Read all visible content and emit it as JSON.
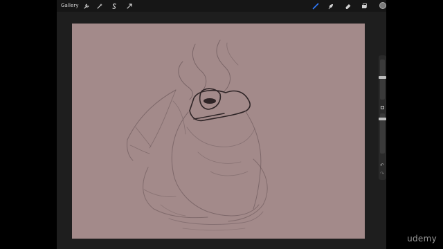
{
  "topbar": {
    "gallery_label": "Gallery",
    "left_tools": [
      {
        "name": "actions",
        "icon": "wrench-icon"
      },
      {
        "name": "adjustments",
        "icon": "magic-wand-icon"
      },
      {
        "name": "selection",
        "icon": "selection-s-icon"
      },
      {
        "name": "transform",
        "icon": "arrow-cursor-icon"
      }
    ],
    "right_tools": [
      {
        "name": "brush",
        "icon": "brush-icon",
        "active": true
      },
      {
        "name": "smudge",
        "icon": "smudge-icon"
      },
      {
        "name": "eraser",
        "icon": "eraser-icon"
      },
      {
        "name": "layers",
        "icon": "layers-icon"
      }
    ],
    "color_swatch": "#7a7a7a"
  },
  "canvas": {
    "background": "#a38a8a",
    "subject": "sketch-drawing"
  },
  "sidebar": {
    "brush_size": 0.55,
    "opacity": 0.9,
    "undo_icon": "undo-icon",
    "redo_icon": "redo-icon"
  },
  "watermark": "udemy",
  "colors": {
    "accent_blue": "#2f7bff",
    "sketch_line": "#6e5a5c"
  }
}
